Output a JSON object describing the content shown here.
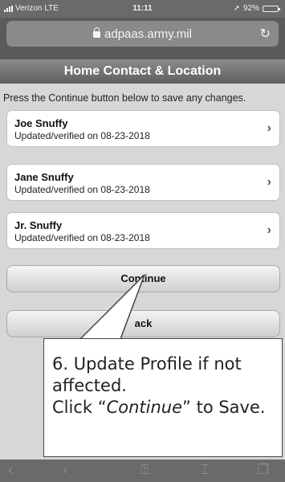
{
  "status_bar": {
    "carrier": "Verizon",
    "network": "LTE",
    "time": "11:11",
    "battery": "92%",
    "battery_level": 0.92
  },
  "address_bar": {
    "url": "adpaas.army.mil"
  },
  "page": {
    "title": "Home Contact & Location",
    "instruction": "Press the Continue button below to save any changes."
  },
  "contacts": [
    {
      "name": "Joe Snuffy",
      "status": "Updated/verified on 08-23-2018"
    },
    {
      "name": "Jane Snuffy",
      "status": "Updated/verified on 08-23-2018"
    },
    {
      "name": "Jr. Snuffy",
      "status": "Updated/verified on 08-23-2018"
    }
  ],
  "buttons": {
    "continue": "Continue",
    "back": "ack"
  },
  "callout": {
    "line1": "6. Update Profile if not",
    "line2": "affected.",
    "line3_pre": "Click “",
    "line3_em": "Continue",
    "line3_post": "” to Save."
  },
  "icons": {
    "lock": "lock-icon",
    "reload": "reload-icon",
    "back": "back-arrow-icon",
    "forward": "forward-arrow-icon",
    "share": "share-icon",
    "bookmarks": "bookmarks-icon",
    "tabs": "tabs-icon"
  }
}
